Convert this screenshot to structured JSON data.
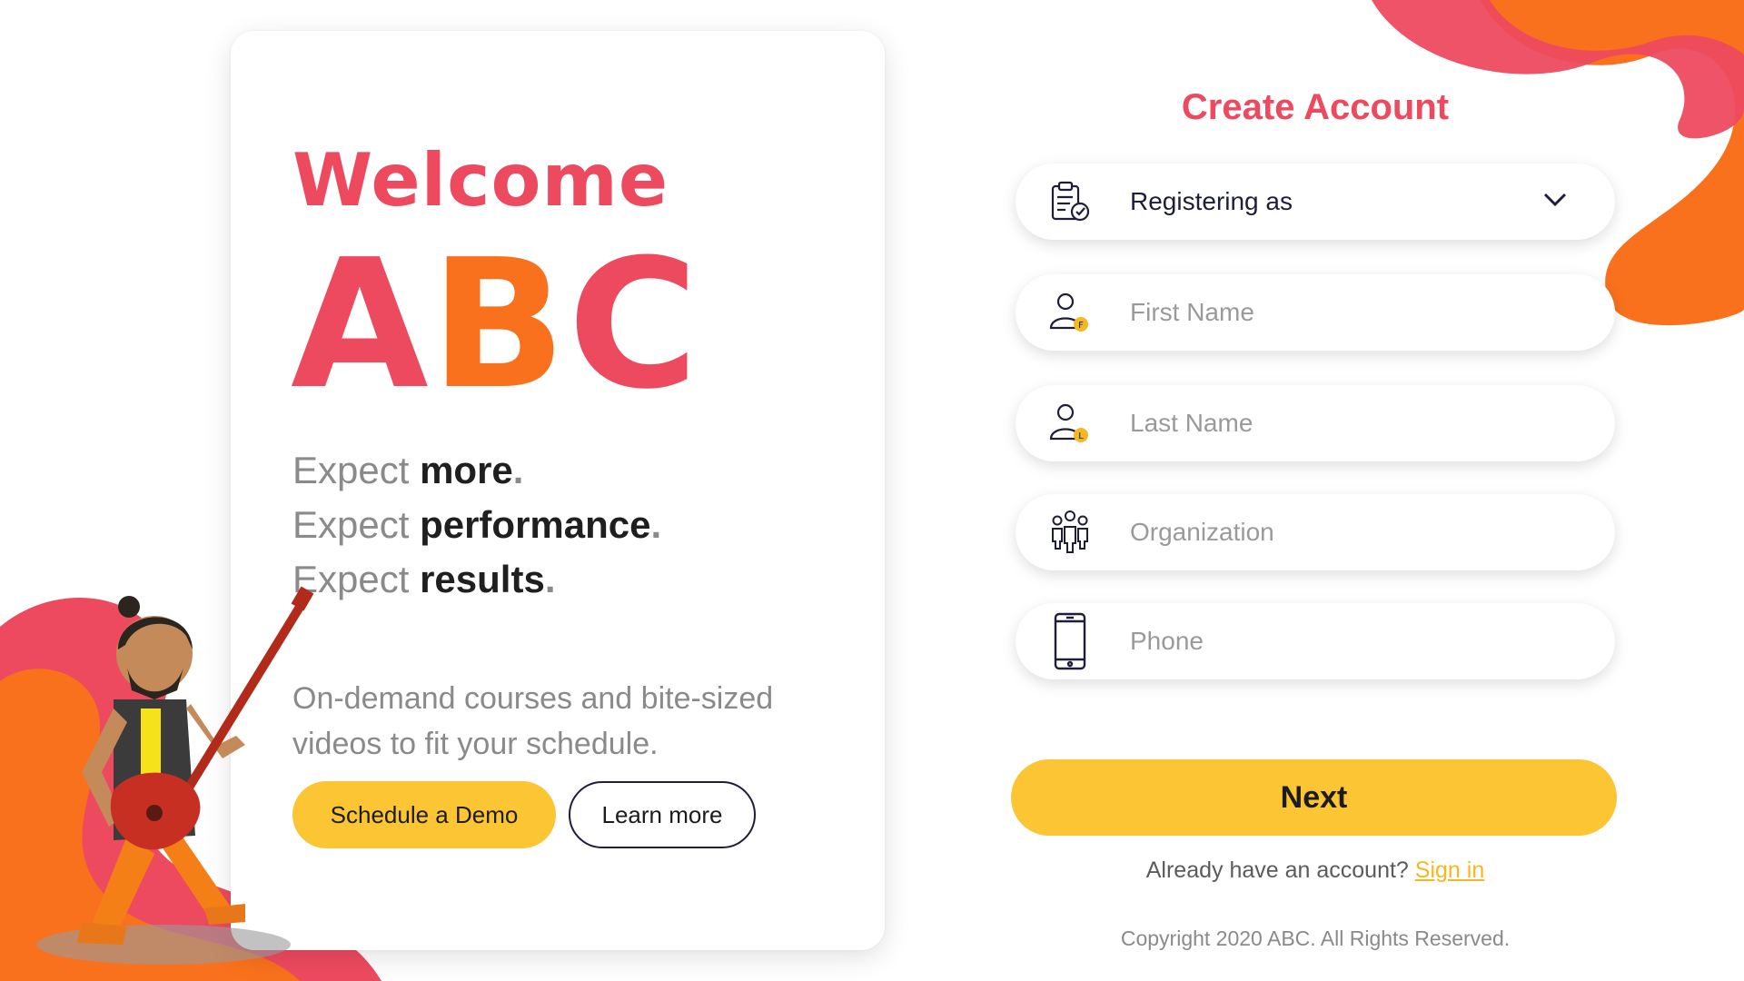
{
  "colors": {
    "primary": "#ee4a5f",
    "accent_orange": "#f9711c",
    "button_yellow": "#fcc533",
    "link_yellow": "#f4b820"
  },
  "hero": {
    "welcome": "Welcome",
    "brand_letters": [
      "A",
      "B",
      "C"
    ],
    "lines": [
      {
        "prefix": "Expect ",
        "bold": "more",
        "dot": "."
      },
      {
        "prefix": "Expect ",
        "bold": "performance",
        "dot": "."
      },
      {
        "prefix": "Expect ",
        "bold": "results",
        "dot": "."
      }
    ],
    "description": "On-demand courses and bite-sized videos to fit your schedule.",
    "demo_button": "Schedule a Demo",
    "learn_button": "Learn more"
  },
  "form": {
    "title": "Create Account",
    "registering": {
      "label": "Registering as",
      "icon": "clipboard-check-icon"
    },
    "first_name": {
      "placeholder": "First Name",
      "icon": "user-f-icon",
      "badge": "F"
    },
    "last_name": {
      "placeholder": "Last Name",
      "icon": "user-l-icon",
      "badge": "L"
    },
    "organization": {
      "placeholder": "Organization",
      "icon": "group-icon"
    },
    "phone": {
      "placeholder": "Phone",
      "icon": "phone-icon"
    },
    "next_button": "Next",
    "signin_prompt": "Already have an account?",
    "signin_link": "Sign in",
    "copyright": "Copyright 2020 ABC. All Rights Reserved."
  }
}
